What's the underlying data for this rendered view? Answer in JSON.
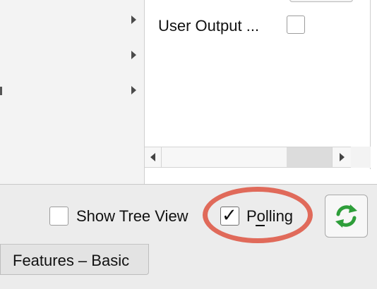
{
  "panel": {
    "row": {
      "label": "User Output ...",
      "checked": false
    }
  },
  "toolbar": {
    "show_tree_view_label": "Show Tree View",
    "show_tree_view_checked": false,
    "polling_label": "Polling",
    "polling_checked": true,
    "polling_check_glyph": "✓",
    "refresh_icon": "refresh-icon",
    "accent_color": "#2e9e3a",
    "annotation_color": "#e06a5a"
  },
  "tabs": [
    {
      "label": "Features – Basic",
      "active": true
    }
  ]
}
